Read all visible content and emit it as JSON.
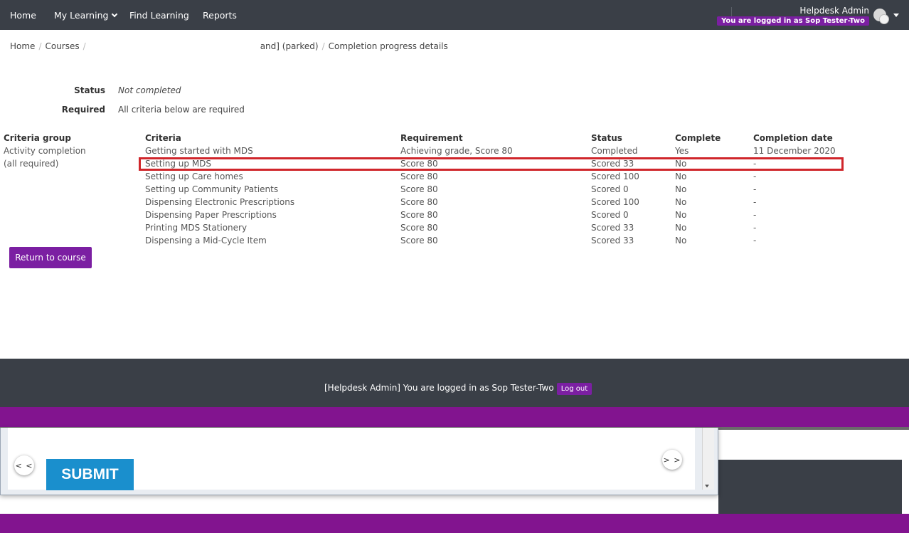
{
  "navbar": {
    "items": [
      {
        "label": "Home"
      },
      {
        "label": "My Learning"
      },
      {
        "label": "Find Learning"
      },
      {
        "label": "Reports"
      }
    ],
    "user_name": "Helpdesk Admin",
    "logged_in_badge": "You are logged in as Sop Tester-Two"
  },
  "breadcrumb": {
    "home": "Home",
    "courses": "Courses",
    "course_fragment": "and] (parked)",
    "current": "Completion progress details"
  },
  "summary": {
    "status_label": "Status",
    "status_value": "Not completed",
    "required_label": "Required",
    "required_value": "All criteria below are required"
  },
  "table": {
    "headers": {
      "group": "Criteria group",
      "criteria": "Criteria",
      "requirement": "Requirement",
      "status": "Status",
      "complete": "Complete",
      "date": "Completion date"
    },
    "group_name": "Activity completion",
    "group_note": "(all required)",
    "rows": [
      {
        "criteria": "Getting started with MDS",
        "requirement": "Achieving grade, Score 80",
        "status": "Completed",
        "complete": "Yes",
        "date": "11 December 2020"
      },
      {
        "criteria": "Setting up MDS",
        "requirement": "Score 80",
        "status": "Scored 33",
        "complete": "No",
        "date": "-"
      },
      {
        "criteria": "Setting up Care homes",
        "requirement": "Score 80",
        "status": "Scored 100",
        "complete": "No",
        "date": "-"
      },
      {
        "criteria": "Setting up Community Patients",
        "requirement": "Score 80",
        "status": "Scored 0",
        "complete": "No",
        "date": "-"
      },
      {
        "criteria": "Dispensing Electronic Prescriptions",
        "requirement": "Score 80",
        "status": "Scored 100",
        "complete": "No",
        "date": "-"
      },
      {
        "criteria": "Dispensing Paper Prescriptions",
        "requirement": "Score 80",
        "status": "Scored 0",
        "complete": "No",
        "date": "-"
      },
      {
        "criteria": "Printing MDS Stationery",
        "requirement": "Score 80",
        "status": "Scored 33",
        "complete": "No",
        "date": "-"
      },
      {
        "criteria": "Dispensing a Mid-Cycle Item",
        "requirement": "Score 80",
        "status": "Scored 33",
        "complete": "No",
        "date": "-"
      }
    ]
  },
  "return_button": "Return to course",
  "footer": {
    "text": "[Helpdesk Admin] You are logged in as Sop Tester-Two",
    "logout": "Log out"
  },
  "overlay": {
    "prev": "< <",
    "next": "> >",
    "submit": "SUBMIT"
  },
  "colors": {
    "navbar": "#3a3f47",
    "accent_purple": "#7b1fa2",
    "highlight_red": "#d0262b",
    "submit_blue": "#1a8fcd"
  }
}
